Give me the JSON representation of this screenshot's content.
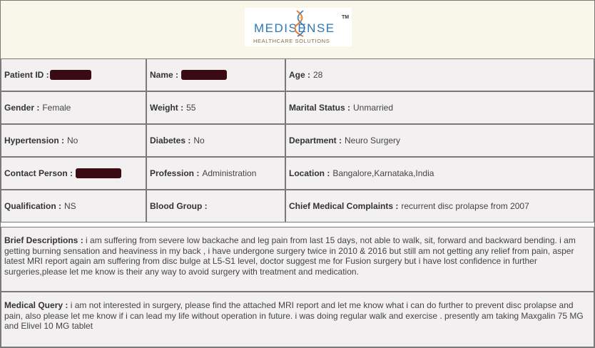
{
  "brand": {
    "name": "MEDISENSE",
    "trademark": "TM",
    "tagline": "HEALTHCARE SOLUTIONS",
    "colors": {
      "primary": "#2e78b6",
      "accent": "#e87a2a",
      "tagline": "#8a6a3a"
    }
  },
  "fields": {
    "patient_id": {
      "label": "Patient ID :",
      "value": ""
    },
    "name": {
      "label": "Name :",
      "value": ""
    },
    "age": {
      "label": "Age :",
      "value": "28"
    },
    "gender": {
      "label": "Gender :",
      "value": "Female"
    },
    "weight": {
      "label": "Weight :",
      "value": "55"
    },
    "marital_status": {
      "label": "Marital Status :",
      "value": "Unmarried"
    },
    "hypertension": {
      "label": "Hypertension :",
      "value": "No"
    },
    "diabetes": {
      "label": "Diabetes :",
      "value": "No"
    },
    "department": {
      "label": "Department :",
      "value": "Neuro Surgery"
    },
    "contact_person": {
      "label": "Contact Person :",
      "value": ""
    },
    "profession": {
      "label": "Profession :",
      "value": "Administration"
    },
    "location": {
      "label": "Location :",
      "value": "Bangalore,Karnataka,India"
    },
    "qualification": {
      "label": "Qualification :",
      "value": "NS"
    },
    "blood_group": {
      "label": "Blood Group :",
      "value": ""
    },
    "chief_complaints": {
      "label": "Chief Medical Complaints :",
      "value": "recurrent disc prolapse from 2007"
    }
  },
  "brief_descriptions": {
    "label": "Brief Descriptions :",
    "text": "i am suffering from severe low backache and leg pain from last 15 days, not able to walk, sit, forward and backward bending. i am getting burning sensation and heaviness in my back , i have undergone surgery twice in 2010 & 2016 but still am not getting any relief from pain, asper latest MRI report again am suffering from disc bulge at L5-S1 level, doctor suggest me for Fusion surgery but i have lost confidence in further surgeries,please let me know is their any way to avoid surgery with treatment and medication."
  },
  "medical_query": {
    "label": "Medical Query :",
    "text": "i am not interested in surgery, please find the attached MRI report and let me know what i can do further to prevent disc prolapse and pain, also please let me know if i can lead my life without operation in future. i was doing regular walk and exercise . presently am taking Maxgalin 75 MG and Elivel 10 MG tablet"
  },
  "redaction_color": "#3a0b12"
}
